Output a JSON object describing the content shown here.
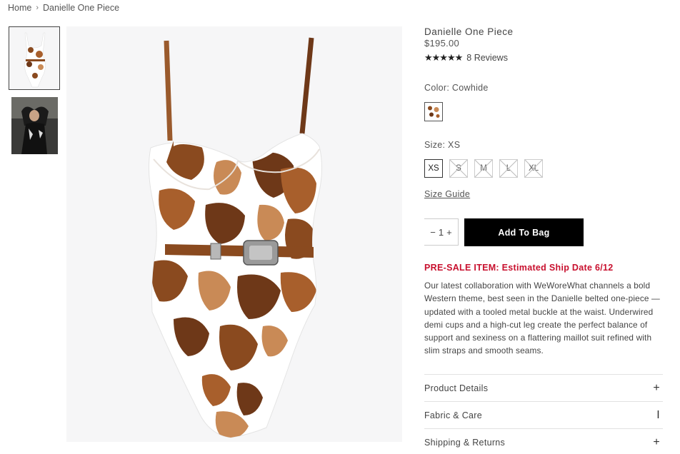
{
  "breadcrumb": {
    "home": "Home",
    "sep": "›",
    "current": "Danielle One Piece"
  },
  "product": {
    "title": "Danielle One Piece",
    "price": "$195.00",
    "stars": "★★★★★",
    "reviews": "8 Reviews",
    "color_label": "Color: Cowhide",
    "size_label": "Size: XS",
    "sizes": [
      "XS",
      "S",
      "M",
      "L",
      "XL"
    ],
    "size_guide": "Size Guide",
    "quantity": "1",
    "qty_minus": "−",
    "qty_plus": "+",
    "add_to_bag": "Add To Bag",
    "presale": "PRE-SALE ITEM: Estimated Ship Date 6/12",
    "description": "Our latest collaboration with WeWoreWhat channels a bold Western theme, best seen in the Danielle belted one-piece — updated with a tooled metal buckle at the waist. Underwired demi cups and a high-cut leg create the perfect balance of support and sexiness on a flattering maillot suit refined with slim straps and smooth seams."
  },
  "accordion": [
    {
      "label": "Product Details",
      "sign": "+"
    },
    {
      "label": "Fabric & Care",
      "sign": "I"
    },
    {
      "label": "Shipping & Returns",
      "sign": "+"
    }
  ],
  "colors": {
    "brown": "#8a4a1f",
    "tan": "#c98a56",
    "presale_red": "#c8102e"
  }
}
